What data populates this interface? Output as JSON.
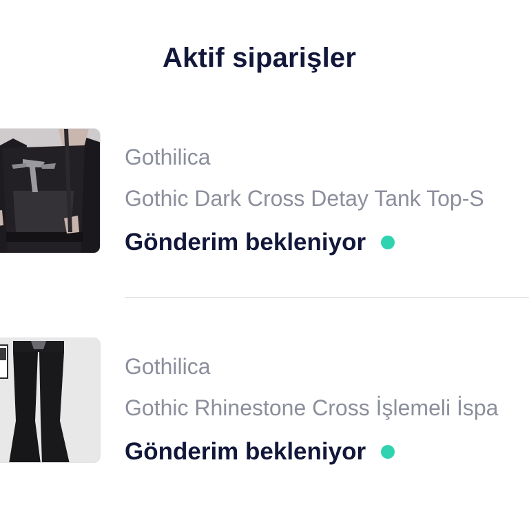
{
  "page": {
    "title": "Aktif siparişler"
  },
  "orders": [
    {
      "brand": "Gothilica",
      "product_name": "Gothic Dark Cross Detay Tank Top-S",
      "status": "Gönderim bekleniyor",
      "thumbnail": "black-cross-top-photo"
    },
    {
      "brand": "Gothilica",
      "product_name": "Gothic Rhinestone Cross İşlemeli İspa",
      "status": "Gönderim bekleniyor",
      "thumbnail": "black-flare-pants-photo"
    }
  ],
  "colors": {
    "title": "#12173a",
    "muted_text": "#8b8f9c",
    "status_dot": "#2fd3b0",
    "divider": "#e6e7ea"
  }
}
